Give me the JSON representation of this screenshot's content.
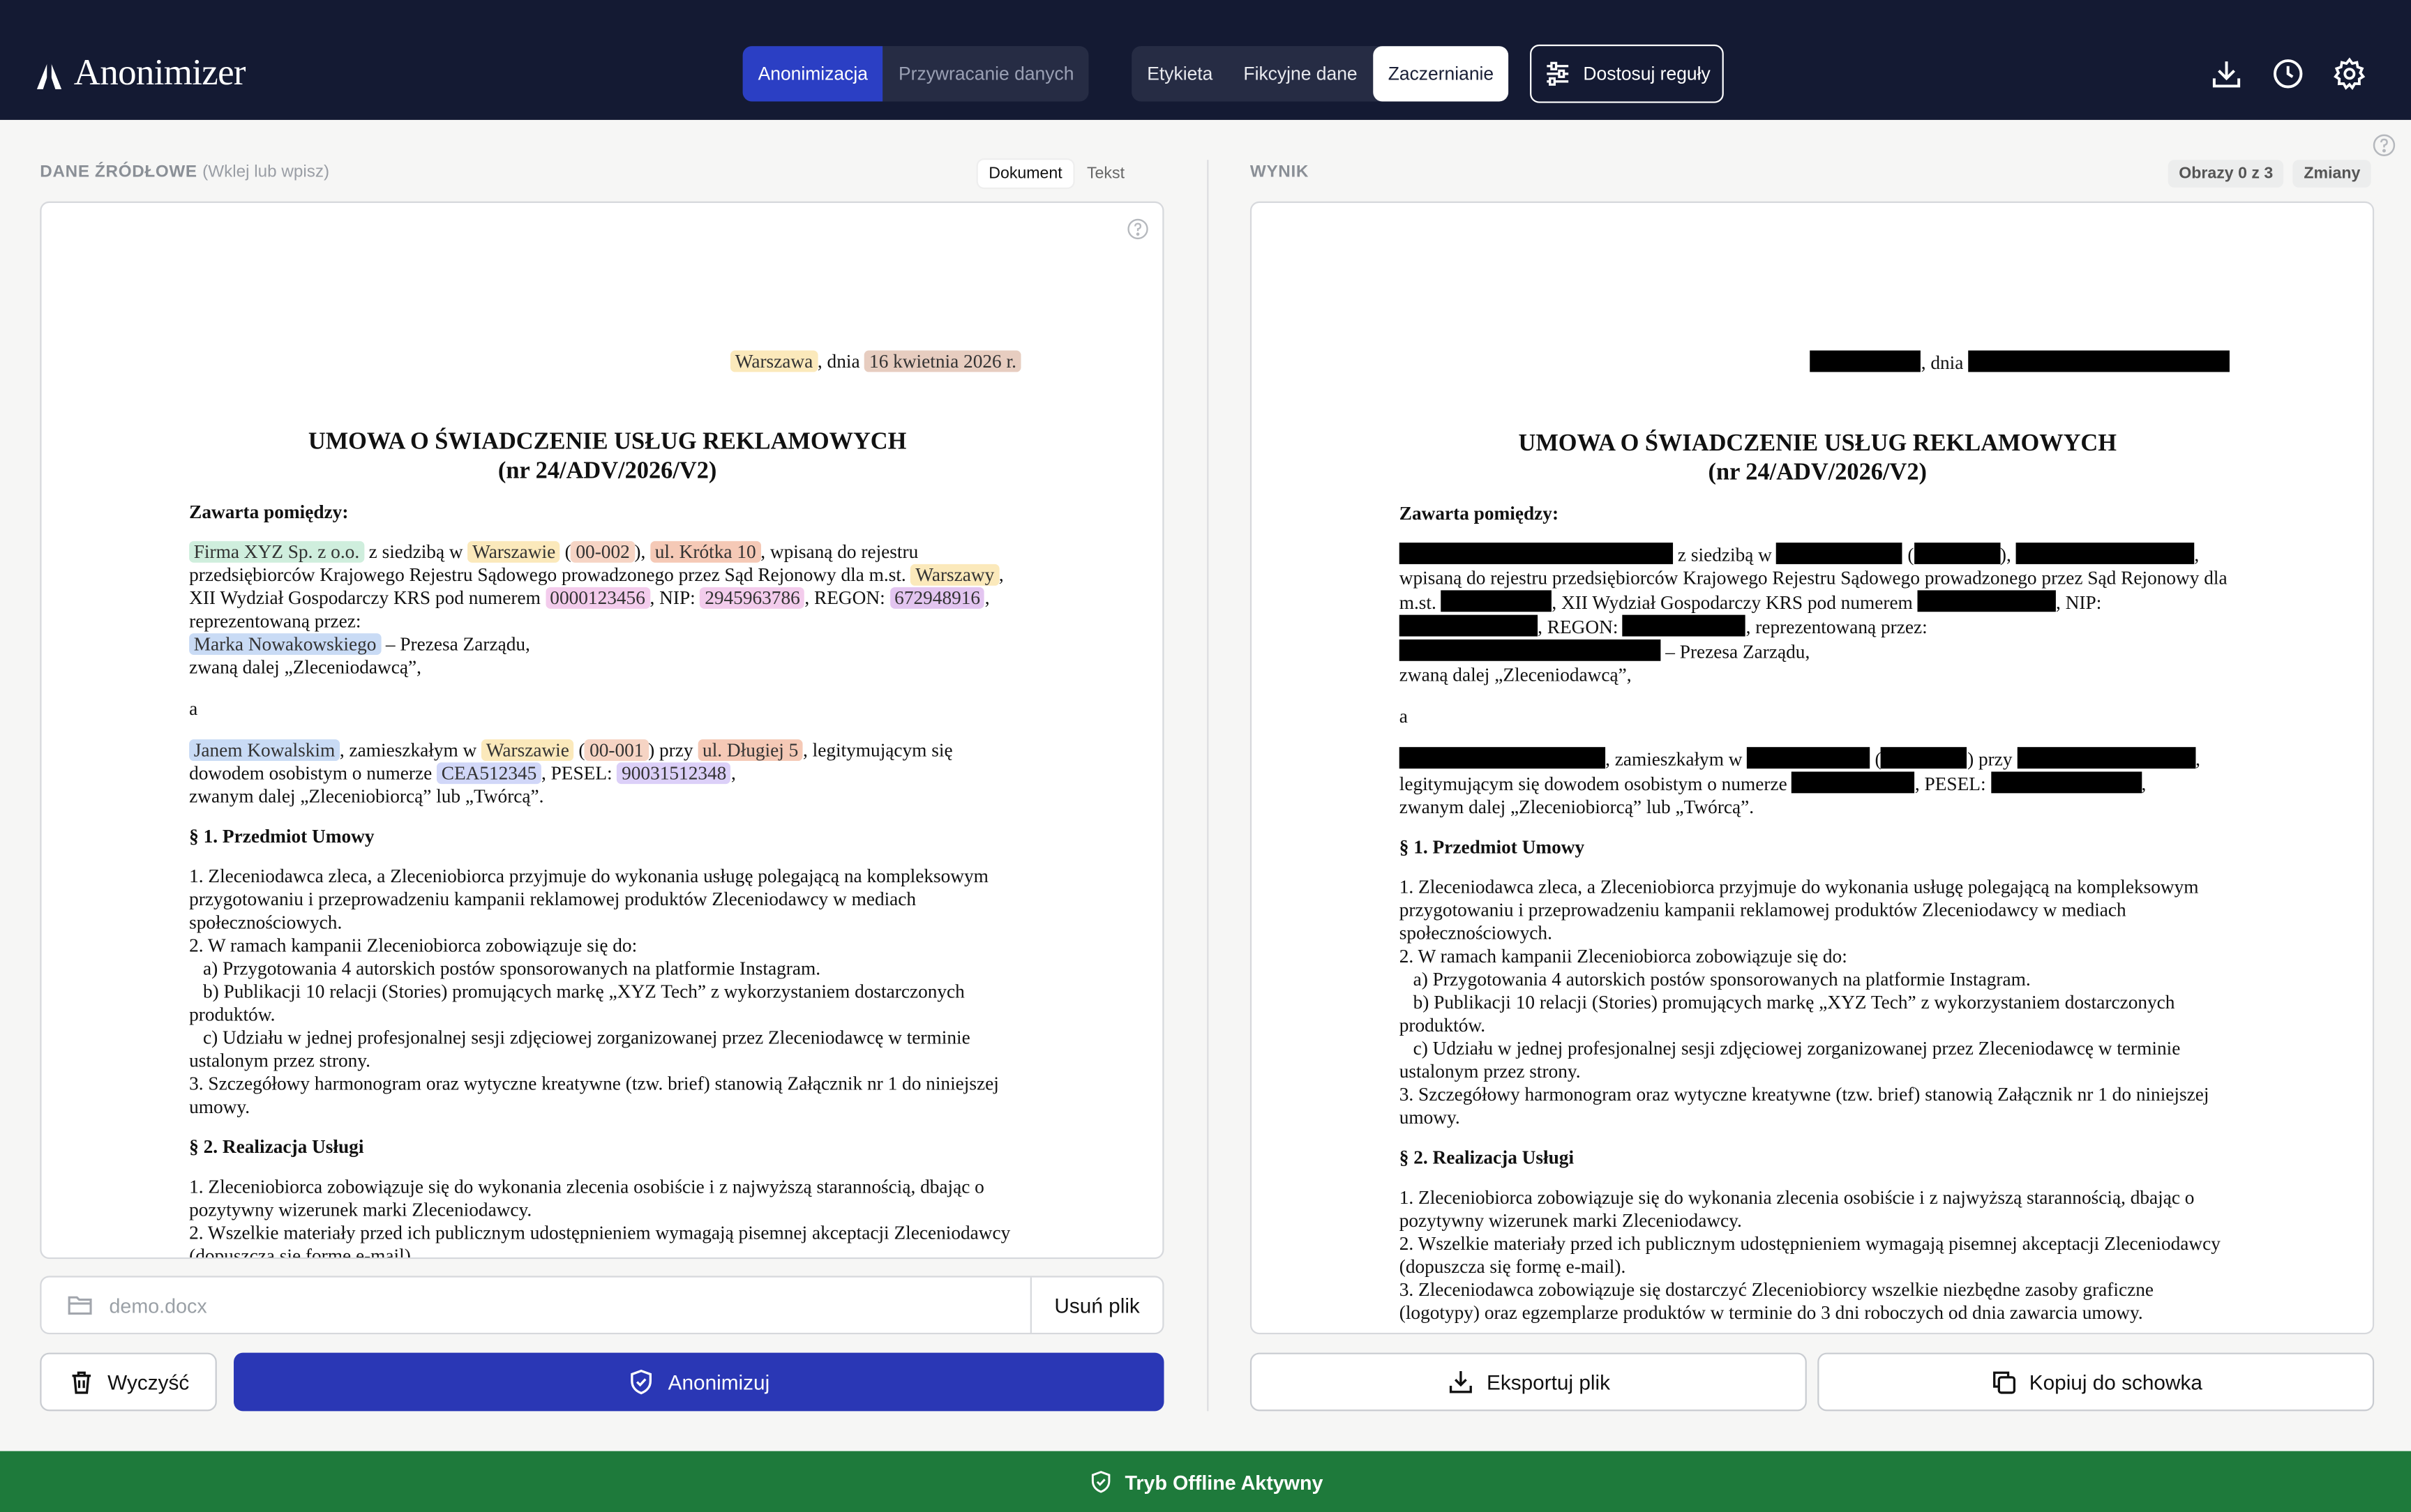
{
  "app": {
    "title": "Anonimizer"
  },
  "modes": [
    {
      "label": "Anonimizacja",
      "active": true
    },
    {
      "label": "Przywracanie danych",
      "active": false
    }
  ],
  "styles": [
    {
      "label": "Etykieta",
      "active": false
    },
    {
      "label": "Fikcyjne dane",
      "active": false
    },
    {
      "label": "Zaczernianie",
      "active": true
    }
  ],
  "rules_button": "Dostosuj reguły",
  "source": {
    "label": "DANE ŹRÓDŁOWE",
    "sublabel": "(Wklej lub wpisz)",
    "views": [
      {
        "label": "Dokument",
        "active": true
      },
      {
        "label": "Tekst",
        "active": false
      }
    ],
    "file_name": "demo.docx",
    "remove_file": "Usuń plik",
    "clear_button": "Wyczyść",
    "anonymize_button": "Anonimizuj"
  },
  "result": {
    "label": "WYNIK",
    "images_badge": "Obrazy 0 z 3",
    "changes_badge": "Zmiany",
    "export_button": "Eksportuj plik",
    "copy_button": "Kopiuj do schowka"
  },
  "doc": {
    "city": "Warszawa",
    "date_prefix": ", dnia",
    "date": "16 kwietnia 2026 r.",
    "title1": "UMOWA O ŚWIADCZENIE USŁUG REKLAMOWYCH",
    "title2": "(nr 24/ADV/2026/V2)",
    "between": "Zawarta pomiędzy:",
    "org": "Firma XYZ Sp. z o.o.",
    "t_seat": "z siedzibą w",
    "org_city": "Warszawie",
    "org_post": "00-002",
    "org_street": "ul. Krótka 10",
    "t_registered": ", wpisaną do rejestru przedsiębiorców Krajowego Rejestru Sądowego prowadzonego przez Sąd Rejonowy dla m.st.",
    "court_city": "Warszawy",
    "t_krs": ", XII Wydział Gospodarczy KRS pod numerem",
    "krs": "0000123456",
    "t_nip": ", NIP:",
    "nip": "2945963786",
    "t_regon": ", REGON:",
    "regon": "672948916",
    "t_repr": ", reprezentowaną przez:",
    "rep": "Marka Nowakowskiego",
    "t_pres": "– Prezesa Zarządu,",
    "t_client": "zwaną dalej „Zleceniodawcą”,",
    "and": "a",
    "person": "Janem Kowalskim",
    "t_resident": ", zamieszkałym w",
    "person_city": "Warszawie",
    "person_post": "00-001",
    "t_at": "przy",
    "person_street": "ul. Długiej 5",
    "t_id": ", legitymującym się dowodem osobistym o numerze",
    "id_number": "CEA512345",
    "t_pesel": ", PESEL:",
    "pesel": "90031512348",
    "t_contractor": "zwanym dalej „Zleceniobiorcą” lub „Twórcą”.",
    "s1": "§ 1. Przedmiot Umowy",
    "s1p1": "1. Zleceniodawca zleca, a Zleceniobiorca przyjmuje do wykonania usługę polegającą na kompleksowym przygotowaniu i przeprowadzeniu kampanii reklamowej produktów Zleceniodawcy w mediach społecznościowych.",
    "s1p2": "2. W ramach kampanii Zleceniobiorca zobowiązuje się do:",
    "s1a": "a) Przygotowania 4 autorskich postów sponsorowanych na platformie Instagram.",
    "s1b": "b) Publikacji 10 relacji (Stories) promujących markę „XYZ Tech” z wykorzystaniem dostarczonych produktów.",
    "s1c": "c) Udziału w jednej profesjonalnej sesji zdjęciowej zorganizowanej przez Zleceniodawcę w terminie ustalonym przez strony.",
    "s1p3": "3. Szczegółowy harmonogram oraz wytyczne kreatywne (tzw. brief) stanowią Załącznik nr 1 do niniejszej umowy.",
    "s2": "§ 2. Realizacja Usługi",
    "s2p1": "1. Zleceniobiorca zobowiązuje się do wykonania zlecenia osobiście i z najwyższą starannością, dbając o pozytywny wizerunek marki Zleceniodawcy.",
    "s2p2": "2. Wszelkie materiały przed ich publicznym udostępnieniem wymagają pisemnej akceptacji Zleceniodawcy (dopuszcza się formę e-mail).",
    "s2p3": "3. Zleceniodawca zobowiązuje się dostarczyć Zleceniobiorcy wszelkie niezbędne zasoby graficzne (logotypy) oraz egzemplarze produktów w terminie do 3 dni roboczych od dnia zawarcia umowy."
  },
  "footer": {
    "status": "Tryb Offline Aktywny"
  },
  "colors": {
    "header": "#141a33",
    "primary": "#2a37b5",
    "footer": "#1e7a3b"
  }
}
